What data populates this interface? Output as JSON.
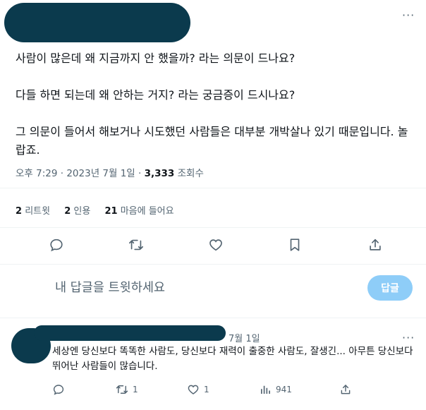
{
  "tweet": {
    "more_label": "···",
    "paragraphs": [
      "사람이 많은데 왜 지금까지 안 했을까? 라는 의문이 드나요?",
      "다들 하면 되는데 왜 안하는 거지? 라는 궁금증이 드시나요?",
      "그 의문이 들어서 해보거나 시도했던 사람들은 대부분 개박살나 있기 때문입니다. 놀랍죠."
    ],
    "time": "오후 7:29",
    "date": "2023년 7월 1일",
    "separator": "·",
    "views_count": "3,333",
    "views_label": "조회수"
  },
  "stats": {
    "retweets_count": "2",
    "retweets_label": "리트윗",
    "quotes_count": "2",
    "quotes_label": "인용",
    "likes_count": "21",
    "likes_label": "마음에 들어요"
  },
  "actions": [
    "reply-icon",
    "retweet-icon",
    "heart-icon",
    "bookmark-icon",
    "share-icon"
  ],
  "reply_composer": {
    "placeholder": "내 답글을 트윗하세요",
    "button_label": "답글"
  },
  "reply": {
    "date": "7월 1일",
    "more_label": "···",
    "text": "세상엔 당신보다 똑똑한 사람도, 당신보다 재력이 출중한 사람도, 잘생긴... 아무튼 당신보다 뛰어난 사람들이 많습니다.",
    "retweets": "1",
    "likes": "1",
    "views": "941"
  },
  "colors": {
    "accent_disabled": "#8ecdf8",
    "redaction": "#0b3a4d",
    "secondary_text": "#536471"
  }
}
